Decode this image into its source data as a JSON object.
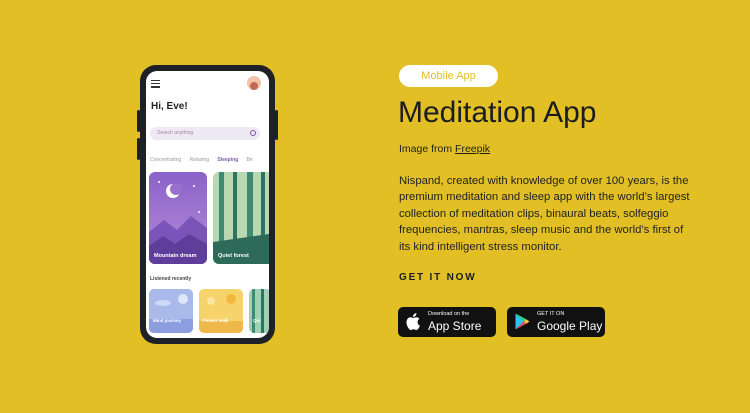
{
  "phone": {
    "greeting": "Hi, Eve!",
    "search_placeholder": "Search anything",
    "tabs": [
      "Concentrating",
      "Relaxing",
      "Sleeping",
      "Be"
    ],
    "cards": [
      "Mountain dream",
      "Quiet forest"
    ],
    "section_title": "Listened recently",
    "recent": [
      "Mind journey",
      "Flower walk",
      "Qui"
    ]
  },
  "tag": "Mobile App",
  "title": "Meditation App",
  "credit": {
    "prefix": "Image from ",
    "link": "Freepik"
  },
  "description": "Nispand, created with knowledge of over 100 years, is the premium meditation and sleep app with the world’s largest collection of meditation clips, binaural beats, solfeggio frequencies, mantras, sleep music and the world’s first of its kind intelligent stress monitor.",
  "cta": "GET IT NOW",
  "stores": {
    "apple": {
      "small": "Download on the",
      "big": "App Store"
    },
    "google": {
      "small": "GET IT ON",
      "big": "Google Play"
    }
  },
  "colors": {
    "background": "#e2bf24",
    "dark": "#1b1d22",
    "accent_purple": "#7b5ca8"
  },
  "icons": [
    "menu-icon",
    "avatar",
    "search-icon",
    "apple-icon",
    "google-play-icon"
  ]
}
